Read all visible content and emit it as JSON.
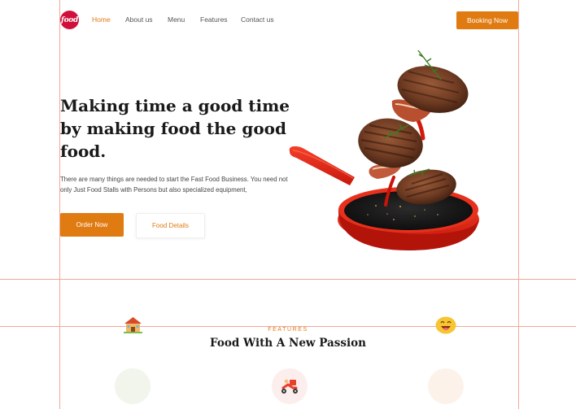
{
  "brand": {
    "logo_text": "food",
    "accent": "#e07b12",
    "logo_color": "#d0103a"
  },
  "nav": {
    "items": [
      "Home",
      "About us",
      "Menu",
      "Features",
      "Contact us"
    ],
    "active_index": 0
  },
  "header": {
    "booking_label": "Booking Now"
  },
  "hero": {
    "title": "Making time a good time by making food the good food.",
    "description": "There are many things are needed to start the Fast Food Business. You need not only Just Food Stalls with Persons but also specialized equipment,",
    "order_label": "Order Now",
    "details_label": "Food Details",
    "image": "frying-pan-with-steaks-illustration"
  },
  "features": {
    "eyebrow": "FEATURES",
    "title": "Food With A New Passion",
    "decor_icons": [
      "house-emoji-icon",
      "smiley-emoji-icon"
    ],
    "cards": [
      {
        "icon": "blank",
        "bg": "#f1f5ec"
      },
      {
        "icon": "delivery-scooter-icon",
        "bg": "#fdeeee"
      },
      {
        "icon": "blank",
        "bg": "#fdf2ea"
      }
    ]
  }
}
